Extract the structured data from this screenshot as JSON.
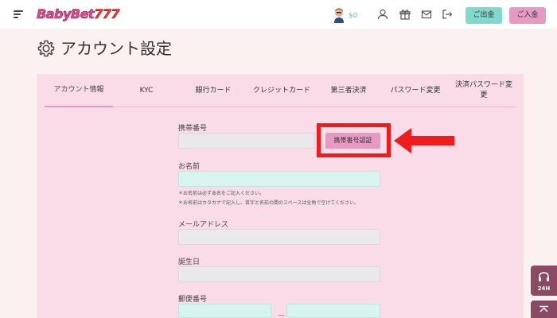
{
  "header": {
    "logo_prefix": "BabyBet",
    "logo_number": "777",
    "balance": "$0",
    "withdraw_label": "ご出金",
    "deposit_label": "ご入金",
    "icons": [
      "user-icon",
      "gift-icon",
      "mail-icon",
      "logout-icon"
    ]
  },
  "page": {
    "title": "アカウント設定"
  },
  "tabs": [
    {
      "label": "アカウント情報",
      "active": true
    },
    {
      "label": "KYC"
    },
    {
      "label": "銀行カード"
    },
    {
      "label": "クレジットカード"
    },
    {
      "label": "第三者決済"
    },
    {
      "label": "パスワード変更"
    },
    {
      "label": "決済パスワード変更"
    }
  ],
  "form": {
    "phone_label": "携帯番号",
    "phone_value": "",
    "verify_button": "携帯番号認証",
    "name_label": "お名前",
    "name_value": "",
    "name_note_1": "＊お名前は必ず本名をご記入ください。",
    "name_note_2": "＊お名前はカタカナで記入し、苗字と名前の間のスペースは全角で空けてください。",
    "email_label": "メールアドレス",
    "email_value": "",
    "birthday_label": "誕生日",
    "birthday_value": "",
    "postal_label": "郵便番号",
    "postal_separator": "—"
  },
  "side": {
    "support_label": "24H"
  },
  "colors": {
    "accent_pink": "#e79ac1",
    "accent_mint": "#7fd9cc",
    "panel_bg": "#f9dce7",
    "highlight_red": "#ee1c1c"
  }
}
